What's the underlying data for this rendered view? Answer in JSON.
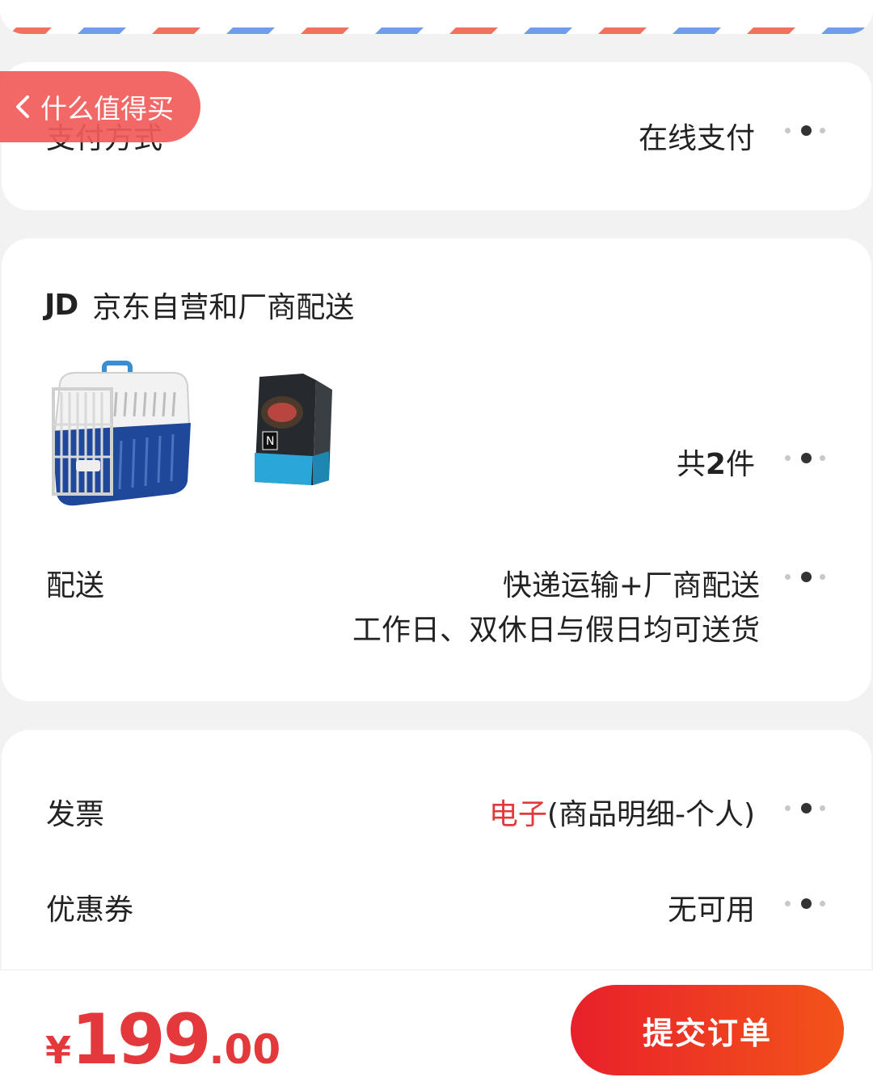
{
  "back_pill": {
    "label": "什么值得买"
  },
  "payment": {
    "label": "支付方式",
    "value": "在线支付"
  },
  "shop": {
    "logo": "JD",
    "name": "京东自营和厂商配送"
  },
  "products": {
    "items": [
      "pet-carrier-image",
      "pet-food-bag-image"
    ],
    "count_prefix": "共",
    "count": "2",
    "count_suffix": "件"
  },
  "delivery": {
    "label": "配送",
    "line1": "快递运输+厂商配送",
    "line2": "工作日、双休日与假日均可送货"
  },
  "invoice": {
    "label": "发票",
    "type": "电子",
    "detail": "(商品明细-个人)"
  },
  "coupon": {
    "label": "优惠券",
    "value": "无可用"
  },
  "footer": {
    "currency": "¥",
    "price_int": "199",
    "price_dec": ".00",
    "submit_label": "提交订单"
  },
  "colors": {
    "accent": "#e4393c",
    "stripe_red": "#f2705f",
    "stripe_blue": "#6f9de8"
  },
  "icons": [
    "chevron-left-icon",
    "more-dots-icon"
  ]
}
